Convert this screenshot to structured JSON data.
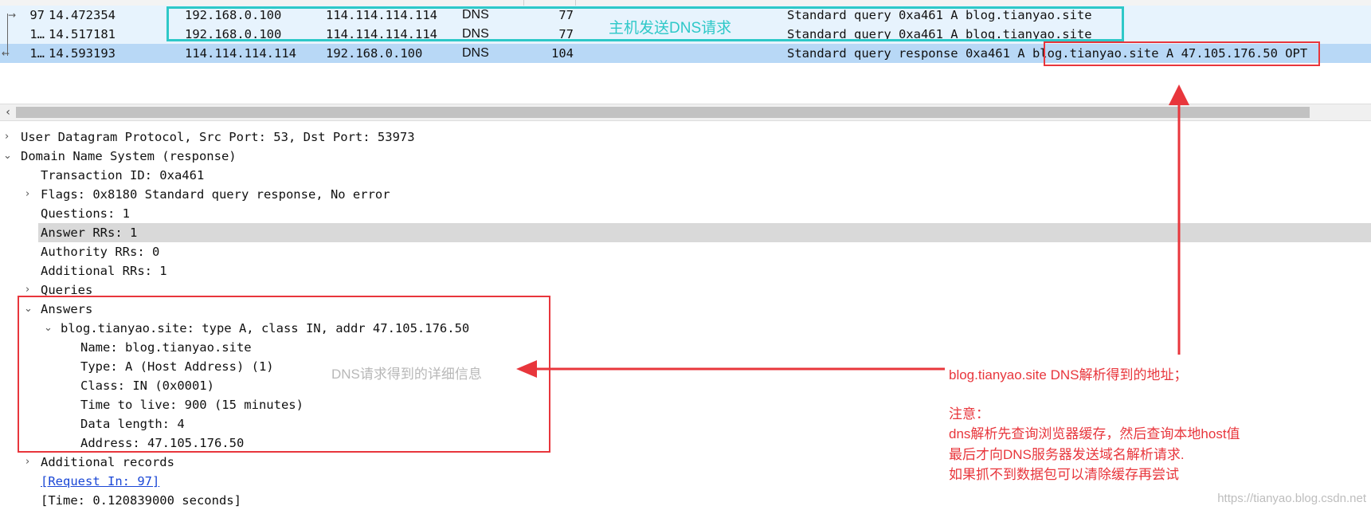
{
  "packets": [
    {
      "no": "97",
      "time": "14.472354",
      "src": "192.168.0.100",
      "dst": "114.114.114.114",
      "proto": "DNS",
      "len": "77",
      "info": "Standard query 0xa461 A blog.tianyao.site"
    },
    {
      "no": "1…",
      "time": "14.517181",
      "src": "192.168.0.100",
      "dst": "114.114.114.114",
      "proto": "DNS",
      "len": "77",
      "info": "Standard query 0xa461 A blog.tianyao.site"
    },
    {
      "no": "1…",
      "time": "14.593193",
      "src": "114.114.114.114",
      "dst": "192.168.0.100",
      "proto": "DNS",
      "len": "104",
      "info": "Standard query response 0xa461 A blog.tianyao.site A 47.105.176.50 OPT"
    }
  ],
  "icons": {
    "request_arrow": "→",
    "response_arrow": "←",
    "collapsed": "›",
    "expanded": "⌄",
    "scroll_left": "‹"
  },
  "details": {
    "udp": "User Datagram Protocol, Src Port: 53, Dst Port: 53973",
    "dns": "Domain Name System (response)",
    "transaction_id": "Transaction ID: 0xa461",
    "flags": "Flags: 0x8180 Standard query response, No error",
    "questions": "Questions: 1",
    "answer_rrs": "Answer RRs: 1",
    "authority_rrs": "Authority RRs: 0",
    "additional_rrs": "Additional RRs: 1",
    "queries": "Queries",
    "answers": "Answers",
    "answer_entry": "blog.tianyao.site: type A, class IN, addr 47.105.176.50",
    "name": "Name: blog.tianyao.site",
    "type": "Type: A (Host Address) (1)",
    "class": "Class: IN (0x0001)",
    "ttl": "Time to live: 900 (15 minutes)",
    "data_length": "Data length: 4",
    "address": "Address: 47.105.176.50",
    "additional_records": "Additional records",
    "request_in": "[Request In: 97]",
    "time": "[Time: 0.120839000 seconds]"
  },
  "annotations": {
    "host_sends": "主机发送DNS请求",
    "dns_detail": "DNS请求得到的详细信息",
    "resolved": "blog.tianyao.site DNS解析得到的地址；",
    "note_title": "注意：",
    "note_1": "dns解析先查询浏览器缓存，然后查询本地host值",
    "note_2": "最后才向DNS服务器发送域名解析请求.",
    "note_3": "如果抓不到数据包可以清除缓存再尝试"
  },
  "colors": {
    "cyan": "#2ec8c8",
    "red": "#e8363c",
    "selected_row": "#b8d8f6",
    "related_row": "#e7f3fd"
  },
  "watermark": "https://tianyao.blog.csdn.net"
}
